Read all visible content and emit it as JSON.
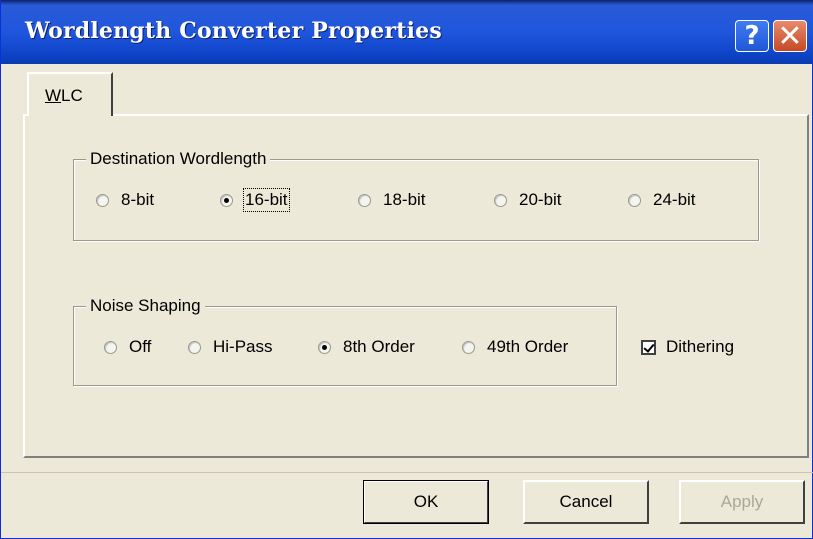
{
  "window": {
    "title": "Wordlength Converter Properties",
    "help_glyph": "?",
    "close_glyph": "✕"
  },
  "tabs": [
    {
      "label": "WLC",
      "mnemonic": "W",
      "rest": "LC",
      "selected": true
    }
  ],
  "destination_group": {
    "title": "Destination Wordlength",
    "options": [
      {
        "label": "8-bit",
        "selected": false
      },
      {
        "label": "16-bit",
        "selected": true
      },
      {
        "label": "18-bit",
        "selected": false
      },
      {
        "label": "20-bit",
        "selected": false
      },
      {
        "label": "24-bit",
        "selected": false
      }
    ]
  },
  "noise_group": {
    "title": "Noise Shaping",
    "options": [
      {
        "label": "Off",
        "selected": false
      },
      {
        "label": "Hi-Pass",
        "selected": false
      },
      {
        "label": "8th Order",
        "selected": true
      },
      {
        "label": "49th Order",
        "selected": false
      }
    ]
  },
  "dithering": {
    "label": "Dithering",
    "checked": true
  },
  "buttons": {
    "ok": "OK",
    "cancel": "Cancel",
    "apply": "Apply"
  },
  "colors": {
    "title_bar": "#1f56dd",
    "dialog_bg": "#ece9d8",
    "close_button": "#c44a25"
  }
}
